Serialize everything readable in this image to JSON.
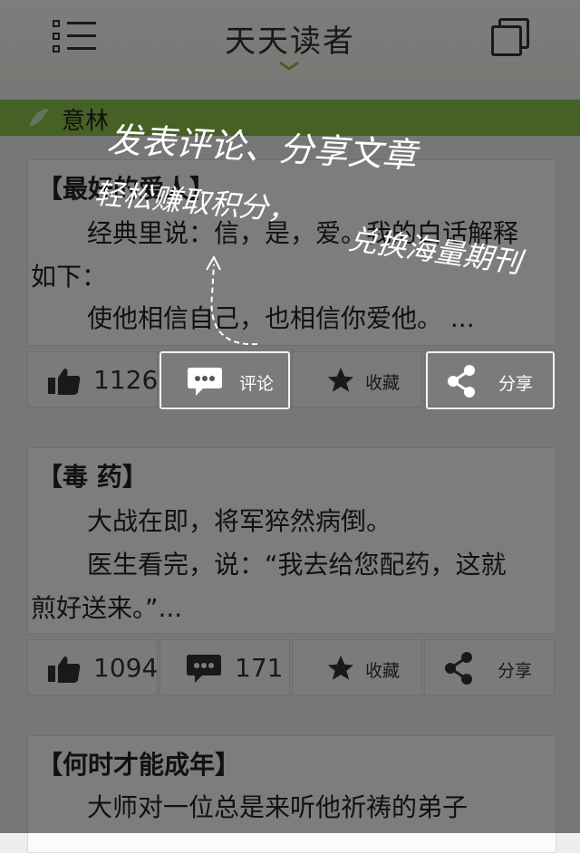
{
  "header": {
    "title": "天天读者"
  },
  "category": {
    "label": "意林"
  },
  "articles": [
    {
      "title": "【最好的爱人】",
      "lines": [
        "经典里说：信，是，爱。我的白话解释",
        "如下：",
        "使他相信自己，也相信你爱他。 ..."
      ],
      "likes": "1126",
      "comment_label": "评论",
      "fav_label": "收藏",
      "share_label": "分享"
    },
    {
      "title": "【毒 药】",
      "lines": [
        "大战在即，将军猝然病倒。",
        "医生看完，说：“我去给您配药，这就",
        "煎好送来。”..."
      ],
      "likes": "1094",
      "comments": "171",
      "fav_label": "收藏",
      "share_label": "分享"
    },
    {
      "title": "【何时才能成年】",
      "lines": [
        "大师对一位总是来听他祈祷的弟子"
      ]
    }
  ],
  "tips": {
    "line1": "发表评论、分享文章",
    "line2": "轻松赚取积分，",
    "line3": "兑换海量期刊"
  },
  "icons": [
    "menu-icon",
    "copy-icon",
    "chevron-down-icon",
    "bird-icon",
    "thumbs-up-icon",
    "comment-icon",
    "star-icon",
    "share-icon"
  ],
  "colors": {
    "category_bar": "#8bc34a",
    "overlay": "rgba(0,0,0,0.5)"
  }
}
